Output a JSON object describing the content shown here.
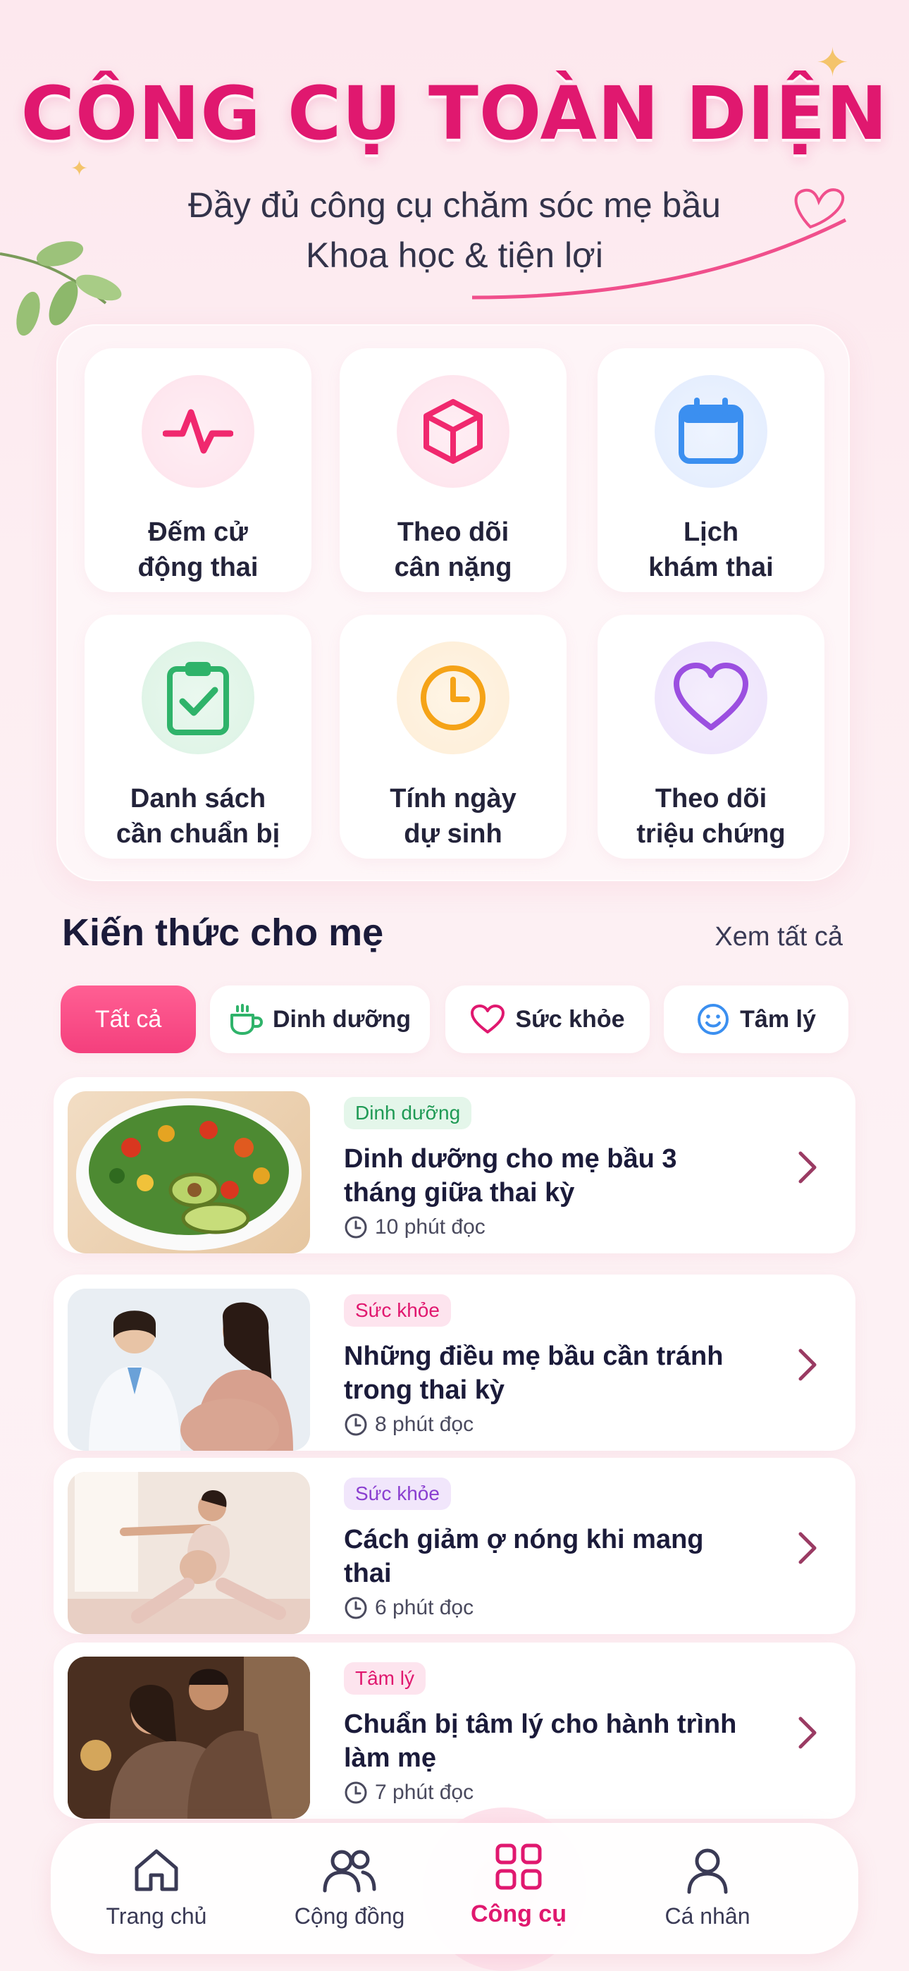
{
  "header": {
    "title": "CÔNG CỤ TOÀN DIỆN",
    "subtitle_line1": "Đầy đủ công cụ chăm sóc mẹ bầu",
    "subtitle_line2": "Khoa học & tiện lợi"
  },
  "tools": [
    {
      "label": "Đếm cử\nđộng thai",
      "icon": "pulse-icon",
      "color": "#f0286e"
    },
    {
      "label": "Theo dõi\ncân nặng",
      "icon": "cube-icon",
      "color": "#f0286e"
    },
    {
      "label": "Lịch\nkhám thai",
      "icon": "calendar-icon",
      "color": "#3b8ff0"
    },
    {
      "label": "Danh sách\ncần chuẩn bị",
      "icon": "clipboard-check-icon",
      "color": "#2fb36a"
    },
    {
      "label": "Tính ngày\ndự sinh",
      "icon": "clock-icon",
      "color": "#f5a317"
    },
    {
      "label": "Theo dõi\ntriệu chứng",
      "icon": "heart-icon",
      "color": "#9b4fe0"
    }
  ],
  "knowledge": {
    "title": "Kiến thức cho mẹ",
    "see_all": "Xem tất cả",
    "chips": [
      {
        "label": "Tất cả",
        "active": true
      },
      {
        "label": "Dinh dưỡng",
        "icon": "cup-icon"
      },
      {
        "label": "Sức khỏe",
        "icon": "heart-outline-icon"
      },
      {
        "label": "Tâm lý",
        "icon": "smile-icon"
      }
    ],
    "articles": [
      {
        "tag": "Dinh dưỡng",
        "title": "Dinh dưỡng cho mẹ bầu 3 tháng giữa thai kỳ",
        "read_time": "10 phút đọc",
        "tag_color": "#1f9a55",
        "tag_bg": "#e4f6ea"
      },
      {
        "tag": "Sức khỏe",
        "title": "Những điều mẹ bầu cần tránh trong thai kỳ",
        "read_time": "8 phút đọc",
        "tag_color": "#e0186f",
        "tag_bg": "#fde4ee"
      },
      {
        "tag": "Sức khỏe",
        "title": "Cách giảm ợ nóng khi mang thai",
        "read_time": "6 phút đọc",
        "tag_color": "#8a3fd0",
        "tag_bg": "#f1e6fb"
      },
      {
        "tag": "Tâm lý",
        "title": "Chuẩn bị tâm lý cho hành trình làm mẹ",
        "read_time": "7 phút đọc",
        "tag_color": "#e0186f",
        "tag_bg": "#fde4ee"
      }
    ]
  },
  "nav": {
    "items": [
      {
        "label": "Trang chủ",
        "icon": "home-icon"
      },
      {
        "label": "Cộng đồng",
        "icon": "community-icon"
      },
      {
        "label": "Công cụ",
        "icon": "grid-icon",
        "active": true
      },
      {
        "label": "Cá nhân",
        "icon": "user-icon"
      }
    ],
    "active_color": "#e0186f"
  }
}
